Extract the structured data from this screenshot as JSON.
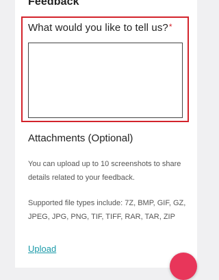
{
  "section": {
    "title": "Feedback"
  },
  "feedback_field": {
    "label": "What would you like to tell us?",
    "required_mark": "*",
    "value": ""
  },
  "attachments": {
    "title": "Attachments (Optional)",
    "description": "You can upload up to 10 screenshots to share details related to your feedback.",
    "file_types": "Supported file types include: 7Z, BMP, GIF, GZ, JPEG, JPG, PNG, TIF, TIFF, RAR, TAR, ZIP",
    "upload_label": "Upload"
  },
  "colors": {
    "accent_red": "#d3232b",
    "link_teal": "#1a9aa9",
    "fab_pink": "#e8365a"
  }
}
